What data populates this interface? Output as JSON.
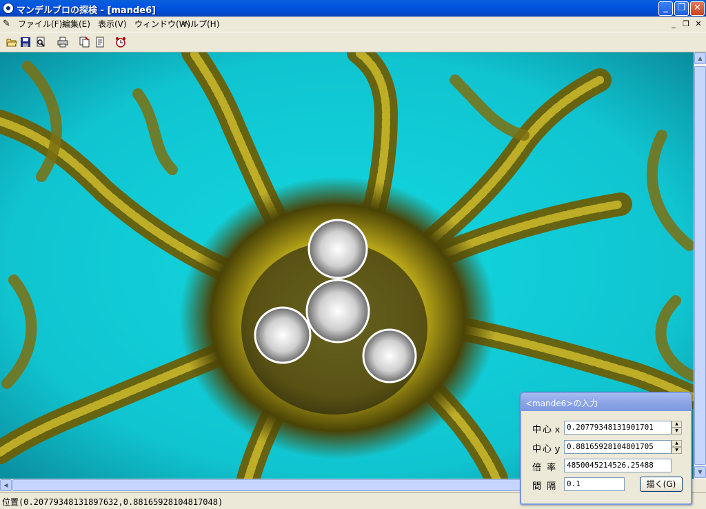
{
  "window": {
    "title": "マンデルブロの探検 - [mande6]"
  },
  "menu": {
    "items": [
      "ファイル(F)",
      "編集(E)",
      "表示(V)",
      "ウィンドウ(W)",
      "ヘルプ(H)"
    ]
  },
  "toolbar": {
    "icons": [
      "open-folder-icon",
      "save-disk-icon",
      "print-preview-icon",
      "print-icon",
      "copy-icon",
      "paste-icon",
      "alarm-clock-icon"
    ]
  },
  "status": {
    "position": "位置(0.20779348131897632,0.88165928104817048)"
  },
  "dialog": {
    "title": "<mande6>の入力",
    "center_x_label": "中心ｘ",
    "center_x_value": "0.20779348131901701",
    "center_y_label": "中心ｙ",
    "center_y_value": "0.88165928104801705",
    "zoom_label": "倍 率",
    "zoom_value": "4850045214526.25488",
    "interval_label": "間 隔",
    "interval_value": "0.1",
    "draw_label": "描く(G)"
  },
  "colors": {
    "cyan": "#0fd4de",
    "gold": "#b5a318",
    "white": "#f2f2f2"
  }
}
